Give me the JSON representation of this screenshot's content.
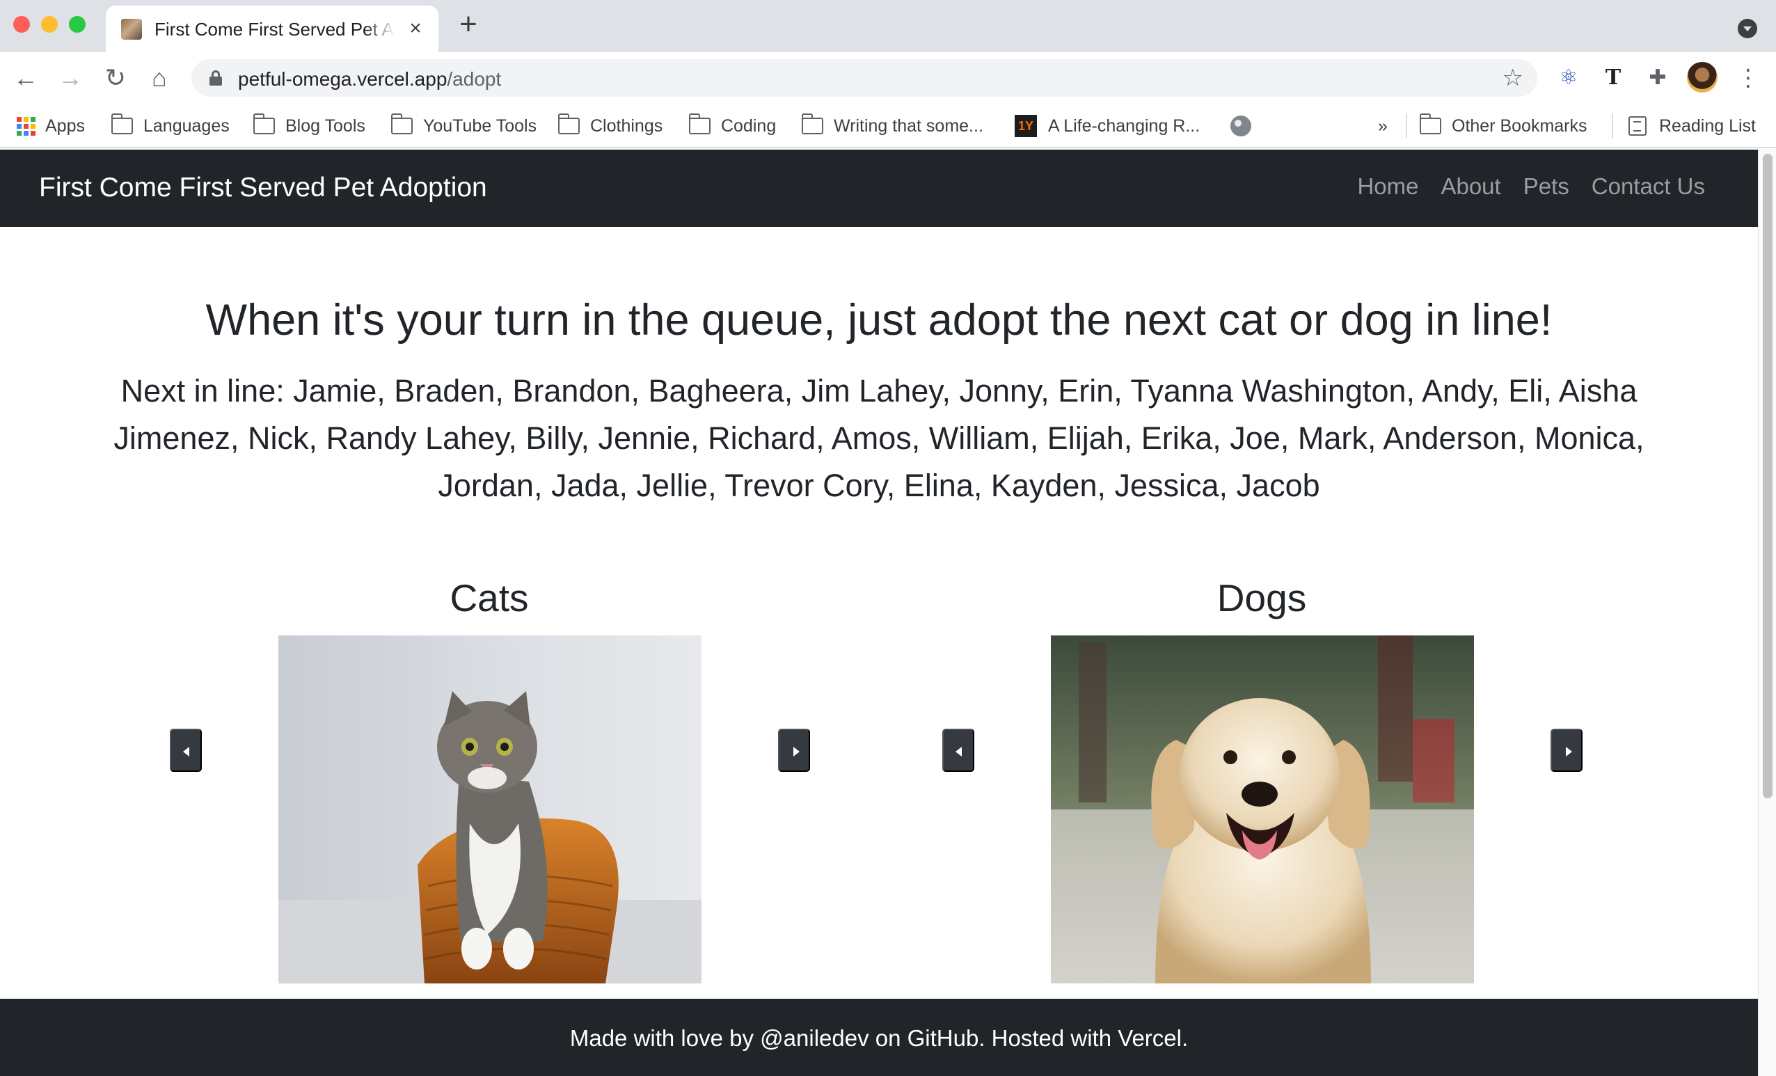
{
  "browser": {
    "tab_title": "First Come First Served Pet Adoption",
    "url_host": "petful-omega.vercel.app",
    "url_path": "/adopt",
    "bookmarks": [
      {
        "label": "Apps",
        "icon": "apps-grid-icon"
      },
      {
        "label": "Languages",
        "icon": "folder-icon"
      },
      {
        "label": "Blog Tools",
        "icon": "folder-icon"
      },
      {
        "label": "YouTube Tools",
        "icon": "folder-icon"
      },
      {
        "label": "Clothings",
        "icon": "folder-icon"
      },
      {
        "label": "Coding",
        "icon": "folder-icon"
      },
      {
        "label": "Writing that some...",
        "icon": "folder-icon"
      },
      {
        "label": "A Life-changing R...",
        "icon": "1y-favicon-icon",
        "badge": "1Y"
      },
      {
        "label": "",
        "icon": "globe-icon"
      }
    ],
    "overflow_label": "»",
    "other_bookmarks": "Other Bookmarks",
    "reading_list": "Reading List"
  },
  "site": {
    "brand": "First Come First Served Pet Adoption",
    "nav": [
      "Home",
      "About",
      "Pets",
      "Contact Us"
    ]
  },
  "main": {
    "headline": "When it's your turn in the queue, just adopt the next cat or dog in line!",
    "queue_text": "Next in line: Jamie, Braden, Brandon, Bagheera, Jim Lahey, Jonny, Erin, Tyanna Washington, Andy, Eli, Aisha Jimenez, Nick, Randy Lahey, Billy, Jennie, Richard, Amos, William, Elijah, Erika, Joe, Mark, Anderson, Monica, Jordan, Jada, Jellie, Trevor Cory, Elina, Kayden, Jessica, Jacob",
    "cats_title": "Cats",
    "dogs_title": "Dogs"
  },
  "footer": {
    "text": "Made with love by @aniledev on GitHub. Hosted with Vercel."
  },
  "colors": {
    "navbar_bg": "#212529",
    "nav_link": "#9a9da1",
    "carousel_button": "#343a40"
  }
}
